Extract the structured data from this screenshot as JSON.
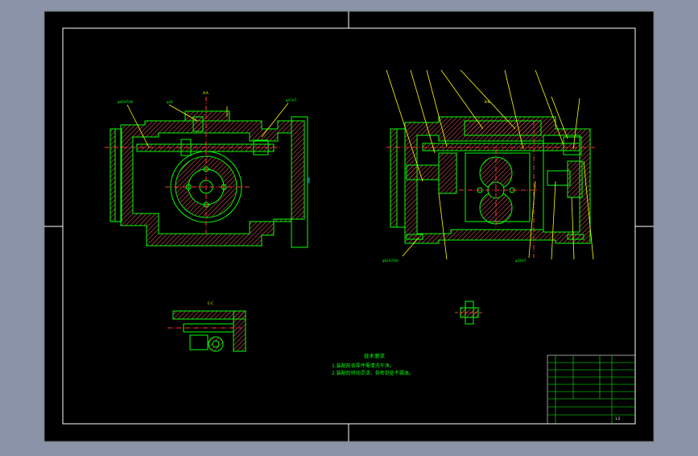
{
  "drawing": {
    "tech_requirements": {
      "title": "技术要求",
      "items": [
        "1.装配前各零件需清洗干净。",
        "2.装配后转动灵活，各密封处不漏油。"
      ]
    },
    "section_labels": [
      "A-A",
      "B-B",
      "C-C"
    ],
    "scale_label": "1:2"
  },
  "colors": {
    "canvas_bg": "#8a93a7",
    "sheet_bg": "#000000",
    "frame": "#ffffff",
    "part_lines": "#00ff00",
    "hatch": "#ff6666",
    "center_lines": "#ff3333",
    "annotations": "#ffff00",
    "leaders": "#ffff00",
    "dimension_text": "#00ffff"
  }
}
